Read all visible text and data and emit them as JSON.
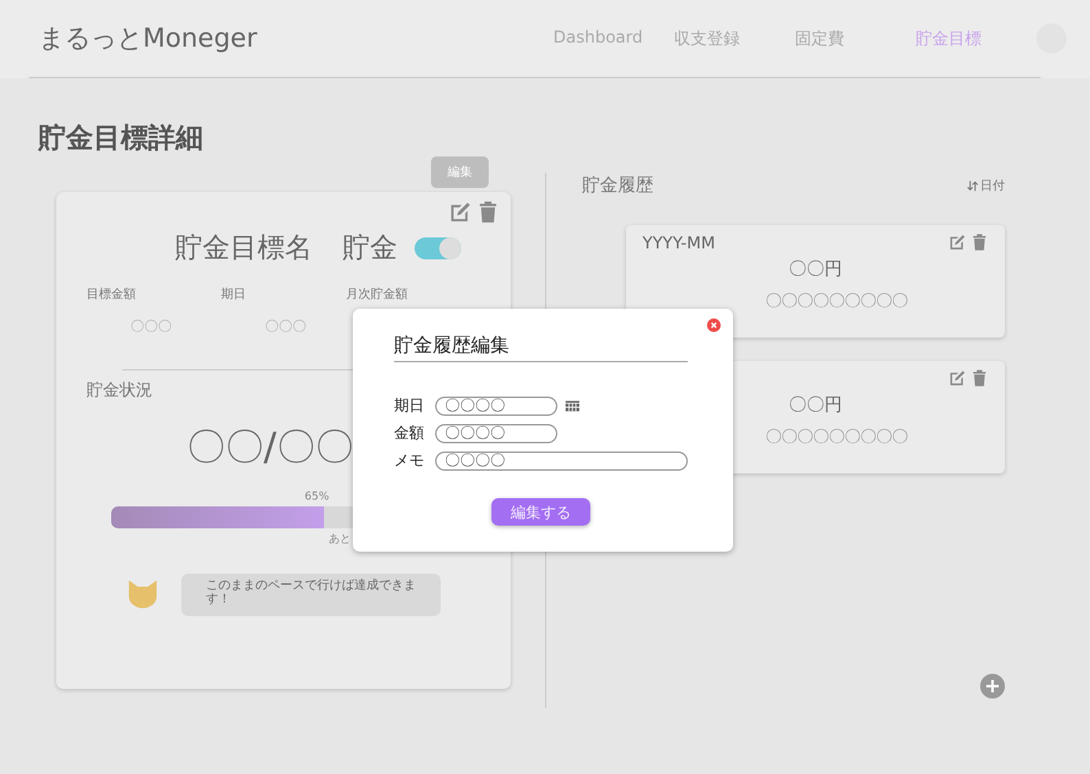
{
  "app": {
    "title": "まるっとMoneger"
  },
  "nav": [
    {
      "label": "Dashboard",
      "selected": false
    },
    {
      "label": "収支登録",
      "selected": false
    },
    {
      "label": "固定費",
      "selected": false
    },
    {
      "label": "貯金目標",
      "selected": true
    }
  ],
  "page_title": "貯金目標詳細",
  "goal_card": {
    "tooltip": "編集",
    "name": "貯金目標名",
    "type_label": "貯金",
    "toggle_on": true,
    "stats": [
      {
        "label": "目標金額",
        "value": "〇〇〇"
      },
      {
        "label": "期日",
        "value": "〇〇〇"
      },
      {
        "label": "月次貯金額"
      }
    ],
    "status_title": "貯金状況",
    "amount": "〇〇/〇〇",
    "progress": {
      "label": "65%",
      "level": 0.65,
      "remaining": "あと"
    },
    "message": "このままのペースで行けば達成できます！"
  },
  "history": {
    "title": "貯金履歴",
    "sort_label": "日付",
    "entries": [
      {
        "date": "YYYY-MM",
        "amount": "〇〇円",
        "memo": "〇〇〇〇〇〇〇〇〇"
      },
      {
        "amount": "〇〇円",
        "memo": "〇〇〇〇〇〇〇〇〇"
      }
    ]
  },
  "modal": {
    "title": "貯金履歴編集",
    "fields": [
      {
        "label": "期日",
        "value": "〇〇〇〇",
        "kind": "date"
      },
      {
        "label": "金額",
        "value": "〇〇〇〇",
        "kind": "short"
      },
      {
        "label": "メモ",
        "value": "〇〇〇〇",
        "kind": "wide"
      }
    ],
    "submit": "編集する"
  }
}
